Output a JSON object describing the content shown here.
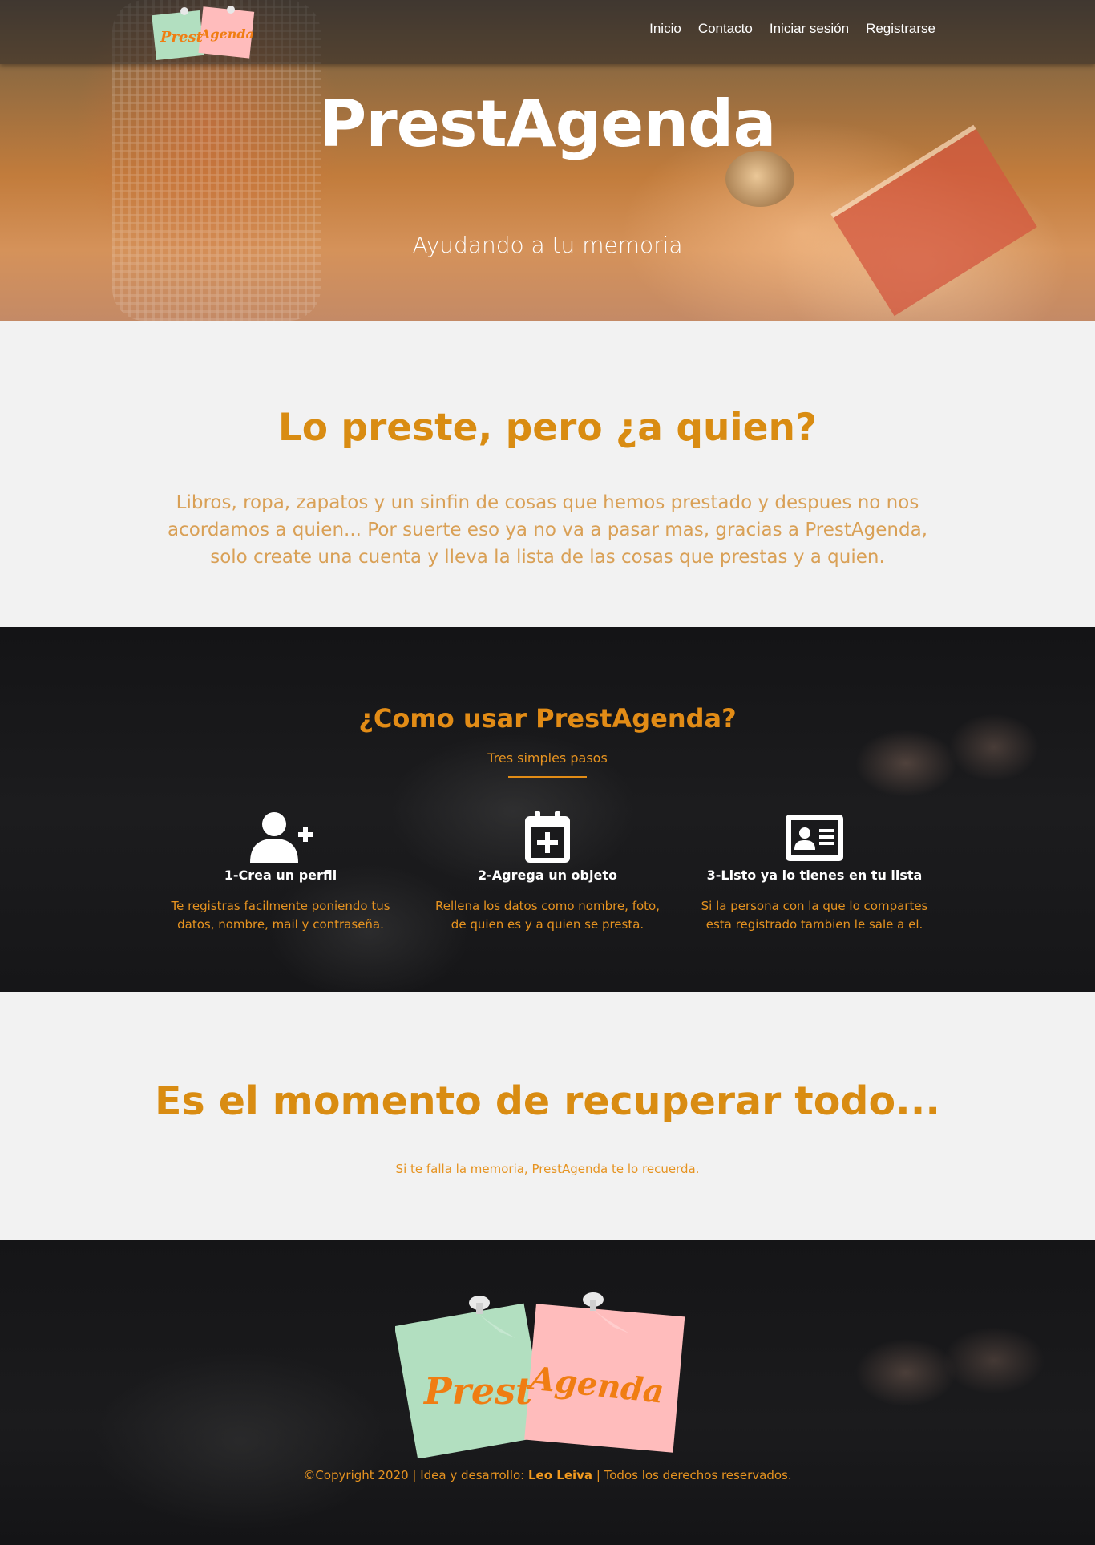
{
  "brand": {
    "logo_word_1": "Prest",
    "logo_word_2": "Agenda",
    "note_green": "#b2dfc0",
    "note_pink": "#ffbcbc",
    "logo_text_color": "#f07d12"
  },
  "nav": {
    "items": [
      "Inicio",
      "Contacto",
      "Iniciar sesión",
      "Registrarse"
    ]
  },
  "hero": {
    "title": "PrestAgenda",
    "subtitle": "Ayudando a tu memoria"
  },
  "intro": {
    "heading": "Lo preste, pero ¿a quien?",
    "body": "Libros, ropa, zapatos y un sinfin de cosas que hemos prestado y despues no nos acordamos a quien... Por suerte eso ya no va a pasar mas, gracias a PrestAgenda, solo create una cuenta y lleva la lista de las cosas que prestas y a quien."
  },
  "how": {
    "heading": "¿Como usar PrestAgenda?",
    "subheading": "Tres simples pasos",
    "steps": [
      {
        "icon": "user-plus-icon",
        "title": "1-Crea un perfil",
        "desc": "Te registras facilmente poniendo tus datos, nombre, mail y contraseña."
      },
      {
        "icon": "calendar-plus-icon",
        "title": "2-Agrega un objeto",
        "desc": "Rellena los datos como nombre, foto, de quien es y a quien se presta."
      },
      {
        "icon": "id-card-icon",
        "title": "3-Listo ya lo tienes en tu lista",
        "desc": "Si la persona con la que lo compartes esta registrado tambien le sale a el."
      }
    ]
  },
  "cta": {
    "heading": "Es el momento de recuperar todo...",
    "text": "Si te falla la memoria, PrestAgenda te lo recuerda."
  },
  "footer": {
    "copyright_pre": "©Copyright 2020 | Idea y desarrollo: ",
    "author": "Leo Leiva",
    "copyright_post": " | Todos los derechos reservados."
  },
  "colors": {
    "accent": "#d98c12",
    "accent_light": "#e69320",
    "dark_bg": "#19191b",
    "light_bg": "#f2f2f2"
  }
}
